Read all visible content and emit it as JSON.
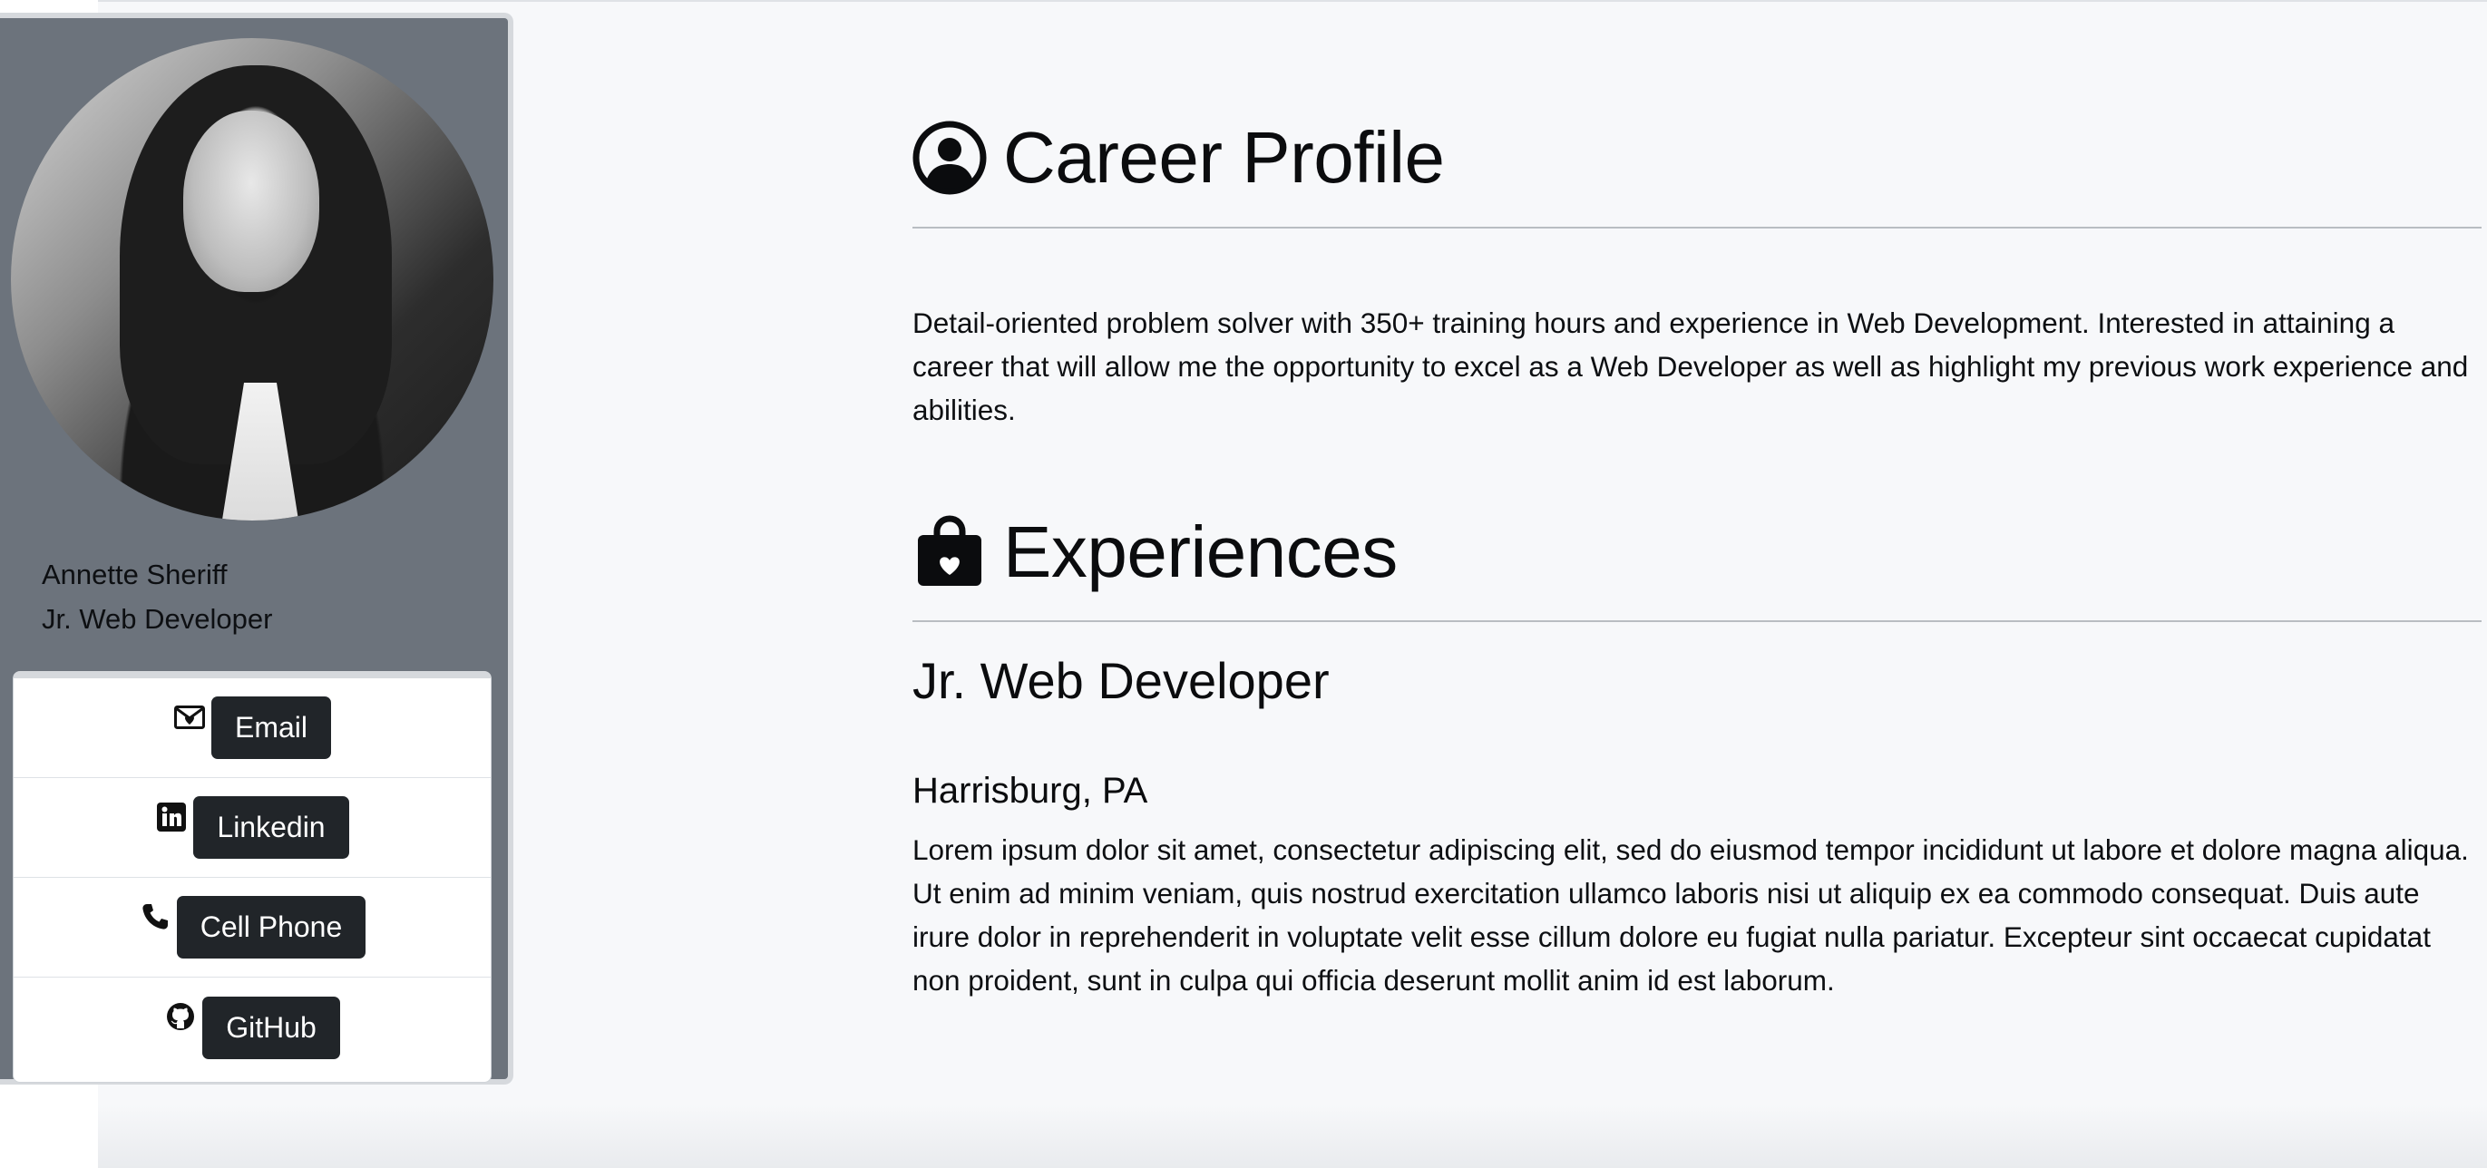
{
  "profile": {
    "name": "Annette Sheriff",
    "role": "Jr. Web Developer"
  },
  "contacts": [
    {
      "icon": "envelope-heart-icon",
      "label": "Email"
    },
    {
      "icon": "linkedin-icon",
      "label": "Linkedin"
    },
    {
      "icon": "phone-icon",
      "label": "Cell Phone"
    },
    {
      "icon": "github-icon",
      "label": "GitHub"
    }
  ],
  "career": {
    "icon": "person-circle-icon",
    "title": "Career Profile",
    "text": "Detail-oriented problem solver with 350+ training hours and experience in Web Development. Interested in attaining a career that will allow me the opportunity to excel as a Web Developer as well as highlight my previous work experience and abilities."
  },
  "experiences": {
    "icon": "bag-heart-icon",
    "title": "Experiences",
    "job_title": "Jr. Web Developer",
    "location": "Harrisburg, PA",
    "description": "Lorem ipsum dolor sit amet, consectetur adipiscing elit, sed do eiusmod tempor incididunt ut labore et dolore magna aliqua. Ut enim ad minim veniam, quis nostrud exercitation ullamco laboris nisi ut aliquip ex ea commodo consequat. Duis aute irure dolor in reprehenderit in voluptate velit esse cillum dolore eu fugiat nulla pariatur. Excepteur sint occaecat cupidatat non proident, sunt in culpa qui officia deserunt mollit anim id est laborum."
  },
  "colors": {
    "sidebar_bg": "#6c737c",
    "button_bg": "#212529",
    "page_bg": "#f7f8fa"
  }
}
